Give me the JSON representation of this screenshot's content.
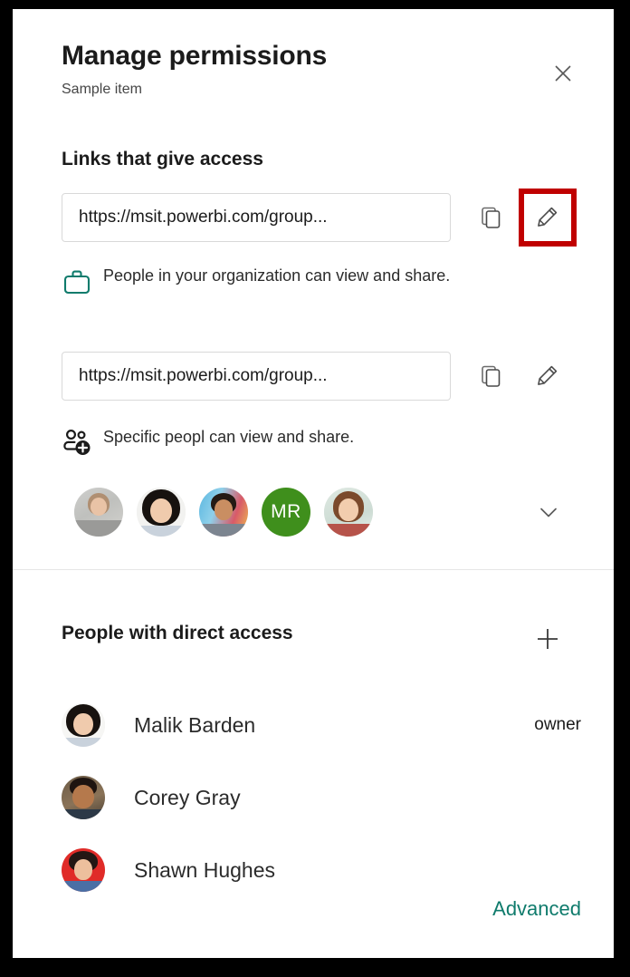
{
  "dialog": {
    "title": "Manage permissions",
    "subtitle": "Sample item",
    "close_icon": "close-icon"
  },
  "links_section": {
    "heading": "Links that give access",
    "links": [
      {
        "url": "https://msit.powerbi.com/group...",
        "description": "People in your organization can view and share.",
        "scope_icon": "briefcase-icon",
        "scope_icon_color": "#0f7b6c",
        "copy_icon": "copy-icon",
        "edit_icon": "pencil-icon",
        "highlighted": true
      },
      {
        "url": "https://msit.powerbi.com/group...",
        "description": "Specific peopl can view and share.",
        "scope_icon": "people-add-icon",
        "scope_icon_color": "#1b1b1b",
        "copy_icon": "copy-icon",
        "edit_icon": "pencil-icon",
        "highlighted": false
      }
    ],
    "shared_avatars": [
      {
        "type": "photo",
        "style": "photo-a"
      },
      {
        "type": "photo",
        "style": "photo-b"
      },
      {
        "type": "photo",
        "style": "photo-c"
      },
      {
        "type": "initials",
        "initials": "MR",
        "color": "#3f8f1c"
      },
      {
        "type": "photo",
        "style": "photo-d"
      }
    ],
    "expand_icon": "chevron-down-icon"
  },
  "direct_access_section": {
    "heading": "People with direct access",
    "add_icon": "plus-icon",
    "people": [
      {
        "name": "Malik Barden",
        "role": "owner",
        "style": "photo-b"
      },
      {
        "name": "Corey Gray",
        "role": "",
        "style": "photo-e"
      },
      {
        "name": "Shawn Hughes",
        "role": "",
        "style": "photo-f"
      }
    ]
  },
  "footer": {
    "advanced_label": "Advanced",
    "advanced_color": "#0f7b6c"
  },
  "highlight": {
    "color": "#c00000"
  }
}
